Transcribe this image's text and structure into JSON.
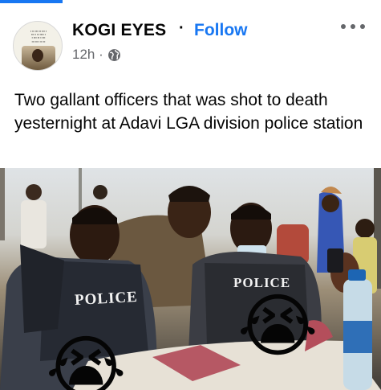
{
  "header": {
    "page_name": "KOGI EYES",
    "separator": "·",
    "follow_label": "Follow",
    "time_label": "12h ·",
    "privacy_icon": "globe-icon",
    "more_icon": "more-options-icon"
  },
  "post": {
    "text": "Two gallant officers that was shot to death yesternight at Adavi LGA division police station"
  },
  "photo": {
    "vest_label_left": "POLICE",
    "vest_label_right": "POLICE",
    "emoji_left": "😭",
    "emoji_right": "😭"
  },
  "colors": {
    "accent": "#1877f2",
    "secondary_text": "#65676b"
  }
}
